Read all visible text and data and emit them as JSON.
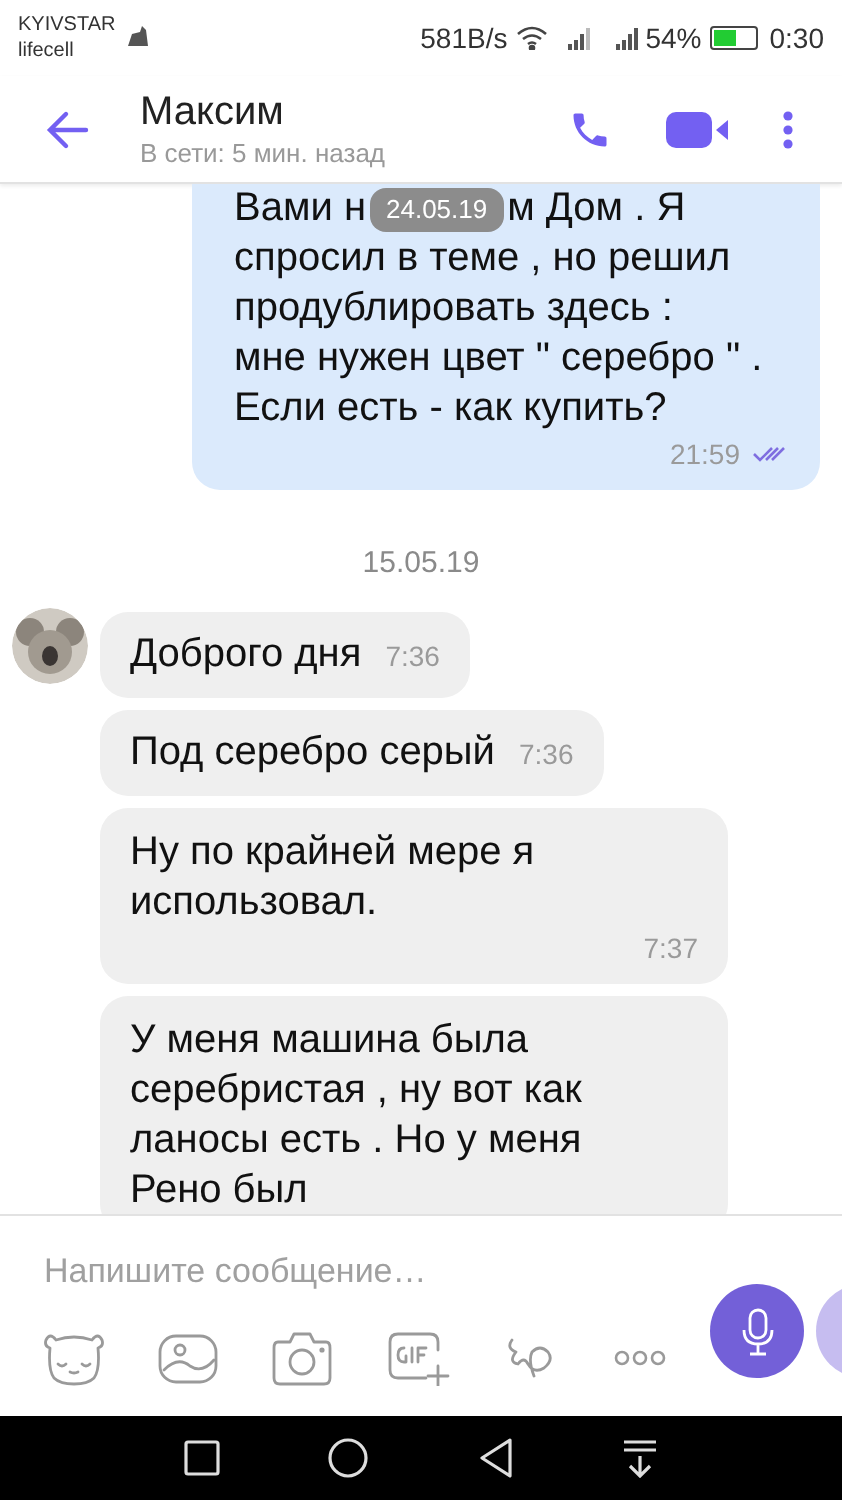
{
  "status_bar": {
    "carrier_1": "KYIVSTAR",
    "carrier_2": "lifecell",
    "speed": "581B/s",
    "battery": "54%",
    "time": "0:30"
  },
  "header": {
    "name": "Максим",
    "status": "В сети: 5 мин. назад"
  },
  "messages": [
    {
      "kind": "outgoing",
      "head_left": "Вами н",
      "chip": "24.05.19",
      "head_right": "м Дом . Я",
      "lines": [
        "спросил в теме , но решил",
        "продублировать здесь :",
        "мне нужен цвет \" серебро \" .",
        "Если есть - как купить?"
      ],
      "time": "21:59",
      "read": true
    },
    {
      "kind": "date",
      "text": "15.05.19"
    },
    {
      "kind": "incoming_inline",
      "avatar": true,
      "text": "Доброго дня",
      "time": "7:36"
    },
    {
      "kind": "incoming_inline",
      "text": "Под серебро серый",
      "time": "7:36"
    },
    {
      "kind": "incoming_block",
      "lines": [
        "Ну по крайней мере я",
        "использовал."
      ],
      "time": "7:37"
    },
    {
      "kind": "incoming_block",
      "lines": [
        "У меня машина была",
        "серебристая , ну вот как",
        "ланосы есть . Но у меня",
        "Рено был"
      ]
    }
  ],
  "composer": {
    "placeholder": "Напишите сообщение…"
  }
}
